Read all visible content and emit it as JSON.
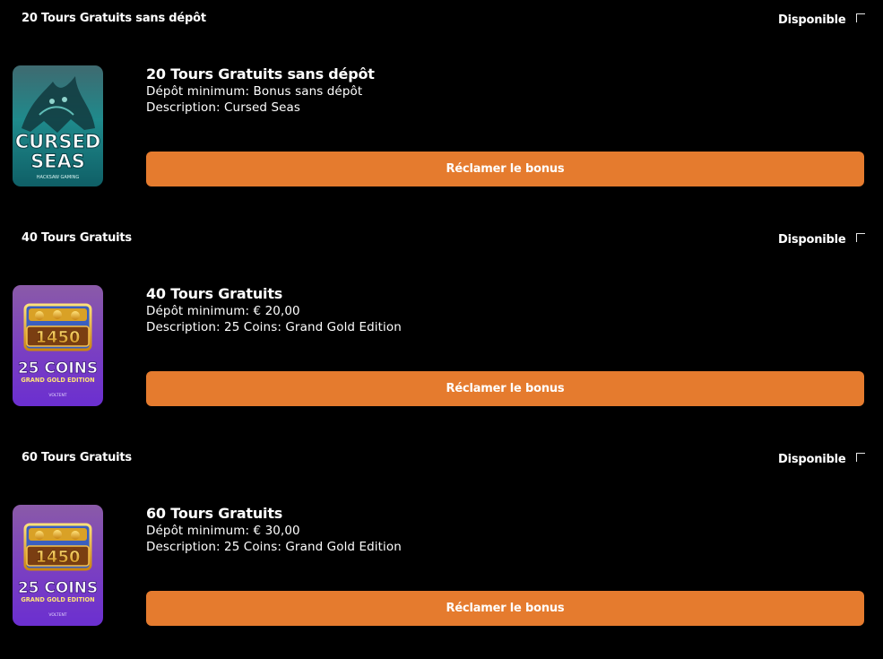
{
  "bonuses": [
    {
      "header_title": "20 Tours Gratuits sans dépôt",
      "status": "Disponible",
      "title": "20 Tours Gratuits sans dépôt",
      "min_deposit": "Dépôt minimum: Bonus sans dépôt",
      "description": "Description: Cursed Seas",
      "claim_label": "Réclamer le bonus",
      "game_art": {
        "line1": "CURSED",
        "line2": "SEAS",
        "studio": "HACKSAW GAMING"
      }
    },
    {
      "header_title": "40 Tours Gratuits",
      "status": "Disponible",
      "title": "40 Tours Gratuits",
      "min_deposit": "Dépôt minimum: € 20,00",
      "description": "Description: 25 Coins: Grand Gold Edition",
      "claim_label": "Réclamer le bonus",
      "game_art": {
        "number": "1450",
        "line1": "25 COINS",
        "line2": "GRAND GOLD EDITION",
        "studio": "VOLTENT"
      }
    },
    {
      "header_title": "60 Tours Gratuits",
      "status": "Disponible",
      "title": "60 Tours Gratuits",
      "min_deposit": "Dépôt minimum: € 30,00",
      "description": "Description: 25 Coins: Grand Gold Edition",
      "claim_label": "Réclamer le bonus",
      "game_art": {
        "number": "1450",
        "line1": "25 COINS",
        "line2": "GRAND GOLD EDITION",
        "studio": "VOLTENT"
      }
    }
  ],
  "colors": {
    "background": "#000000",
    "button": "#e57b2e",
    "text": "#ffffff"
  }
}
